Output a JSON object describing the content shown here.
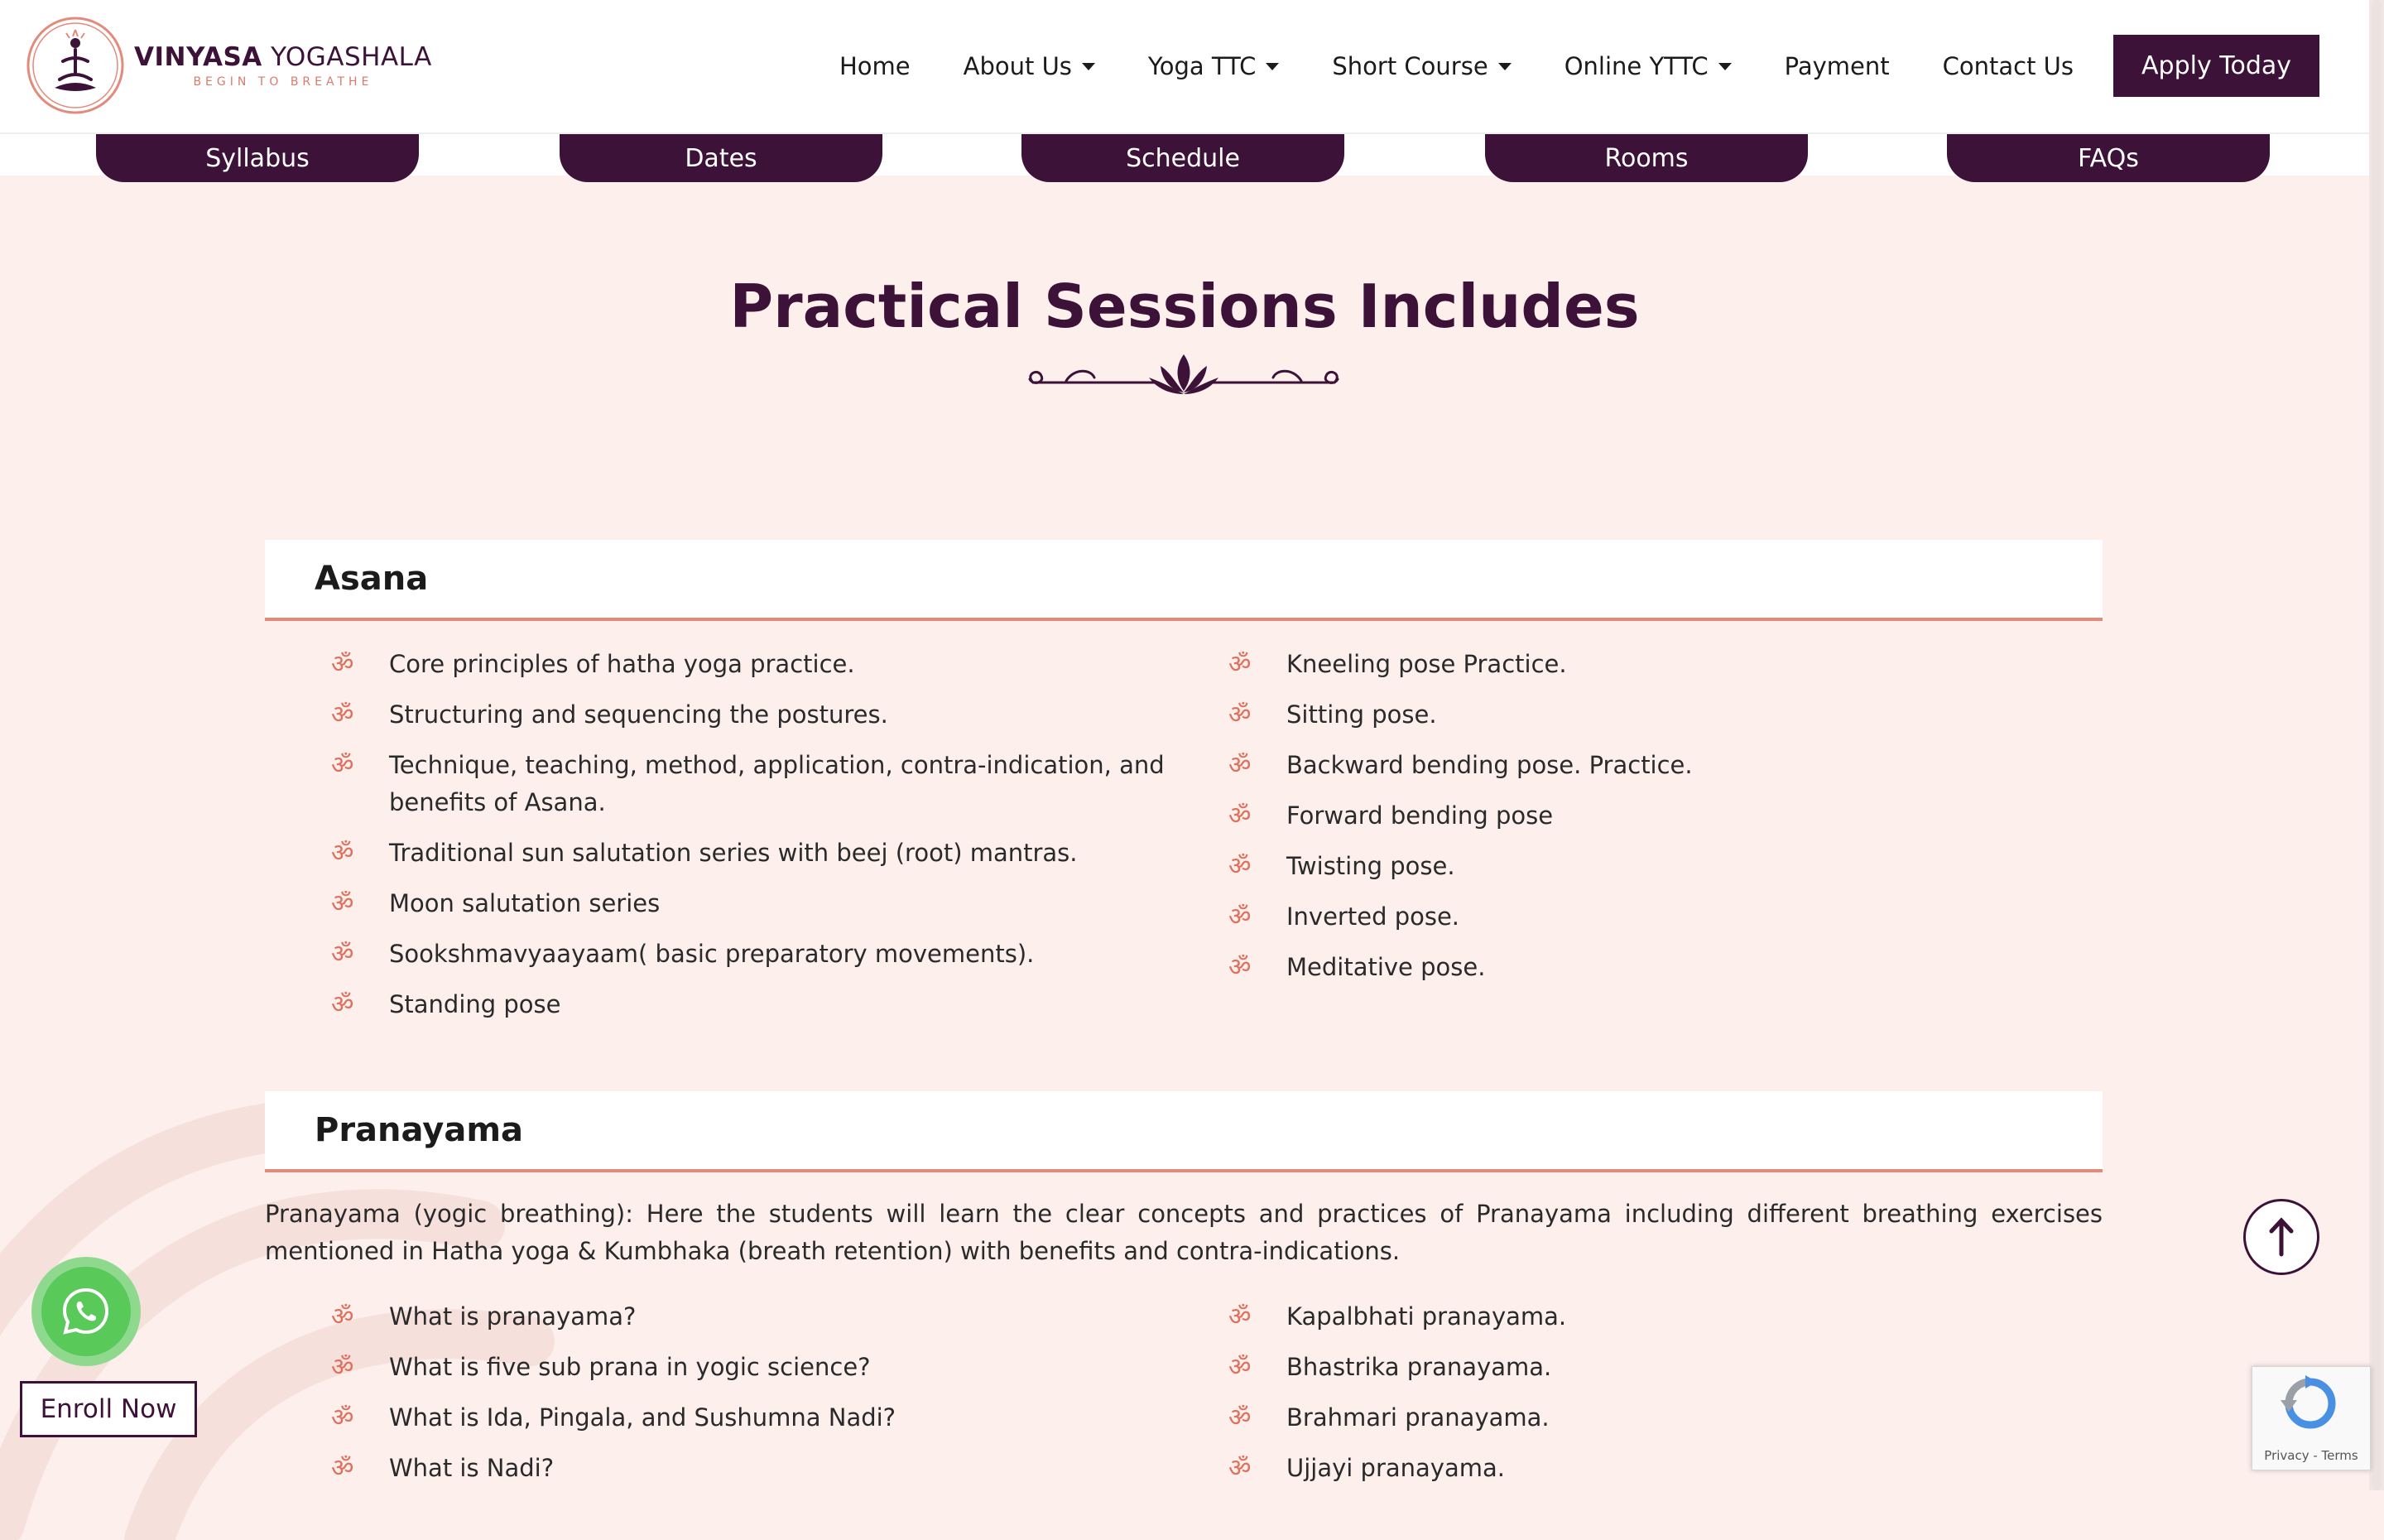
{
  "brand": {
    "name_bold": "VINYASA",
    "name_rest": " YOGASHALA",
    "tagline": "BEGIN TO BREATHE"
  },
  "nav": {
    "items": [
      {
        "label": "Home",
        "dropdown": false
      },
      {
        "label": "About Us",
        "dropdown": true
      },
      {
        "label": "Yoga TTC",
        "dropdown": true
      },
      {
        "label": "Short Course",
        "dropdown": true
      },
      {
        "label": "Online YTTC",
        "dropdown": true
      },
      {
        "label": "Payment",
        "dropdown": false
      },
      {
        "label": "Contact Us",
        "dropdown": false
      }
    ],
    "cta": "Apply Today"
  },
  "tabs": [
    "Syllabus",
    "Dates",
    "Schedule",
    "Rooms",
    "FAQs"
  ],
  "section": {
    "title": "Practical Sessions Includes"
  },
  "asana": {
    "heading": "Asana",
    "left": [
      "Core principles of hatha yoga practice.",
      "Structuring and sequencing the postures.",
      "Technique, teaching, method, application, contra-indication, and benefits of Asana.",
      "Traditional sun salutation series with beej (root) mantras.",
      "Moon salutation series",
      "Sookshmavyaayaam( basic preparatory movements).",
      "Standing pose"
    ],
    "right": [
      "Kneeling pose Practice.",
      "Sitting pose.",
      "Backward bending pose. Practice.",
      "Forward bending pose",
      "Twisting pose.",
      "Inverted pose.",
      "Meditative pose."
    ]
  },
  "pranayama": {
    "heading": "Pranayama",
    "intro": "Pranayama (yogic breathing): Here the students will learn the clear concepts and practices of Pranayama including different breathing exercises mentioned in Hatha yoga & Kumbhaka (breath retention) with benefits and contra-indications.",
    "left": [
      "What is pranayama?",
      "What is five sub prana in yogic science?",
      "What is Ida, Pingala, and Sushumna Nadi?",
      "What is Nadi?"
    ],
    "right": [
      "Kapalbhati pranayama.",
      "Bhastrika pranayama.",
      "Brahmari pranayama.",
      "Ujjayi pranayama."
    ]
  },
  "bullet_glyph": "ॐ",
  "floating": {
    "enroll": "Enroll Now",
    "recaptcha_links": "Privacy - Terms"
  },
  "colors": {
    "brand_purple": "#3d1238",
    "accent_coral": "#e06f5c",
    "background": "#fcefec"
  }
}
